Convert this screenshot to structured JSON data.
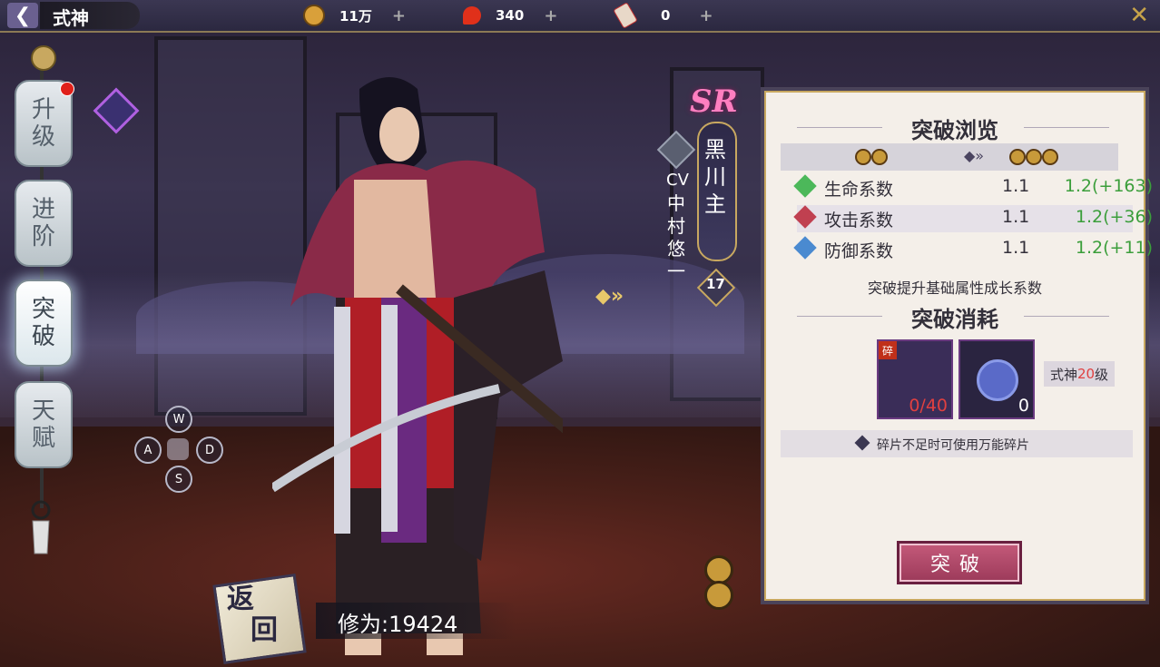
{
  "topbar": {
    "back_icon": "back-arrow-icon",
    "title": "式神",
    "resources": [
      {
        "name": "coin",
        "icon": "gold-coin-icon",
        "value": "11万",
        "color": "#d9a03a"
      },
      {
        "name": "magatama",
        "icon": "magatama-icon",
        "value": "340",
        "color": "#e0301a"
      },
      {
        "name": "ticket",
        "icon": "talisman-ticket-icon",
        "value": "0",
        "color": "#e8d8c8"
      }
    ],
    "plus": "+",
    "close_icon": "close-icon"
  },
  "sidebar": {
    "tabs": [
      {
        "label_top": "升",
        "label_bottom": "级",
        "active": false
      },
      {
        "label_top": "进",
        "label_bottom": "阶",
        "active": false
      },
      {
        "label_top": "突",
        "label_bottom": "破",
        "active": true
      },
      {
        "label_top": "天",
        "label_bottom": "赋",
        "active": false
      }
    ]
  },
  "controls": {
    "w": "W",
    "a": "A",
    "s": "S",
    "d": "D"
  },
  "shikigami": {
    "rarity": "SR",
    "name": "黑川主",
    "cv_label": "CV",
    "cv_name": "中村悠一",
    "level": "17"
  },
  "breakthrough": {
    "preview_title": "突破浏览",
    "stats": [
      {
        "label": "生命系数",
        "current": "1.1",
        "next": "1.2(+163)",
        "icon_color": "#4cb85a"
      },
      {
        "label": "攻击系数",
        "current": "1.1",
        "next": "1.2(+36)",
        "icon_color": "#c04050"
      },
      {
        "label": "防御系数",
        "current": "1.1",
        "next": "1.2(+11)",
        "icon_color": "#4a8ad0"
      }
    ],
    "stat_note": "突破提升基础属性成长系数",
    "cost_title": "突破消耗",
    "fragment": {
      "badge": "碎",
      "count": "0/40"
    },
    "universal_fragment": {
      "count": "0"
    },
    "requirement": {
      "prefix": "式神",
      "level": "20",
      "suffix": "级"
    },
    "tip": "碎片不足时可使用万能碎片",
    "button": "突破"
  },
  "bottom": {
    "return_top": "返",
    "return_bottom": "回",
    "xiuwei": "修为:19424"
  }
}
